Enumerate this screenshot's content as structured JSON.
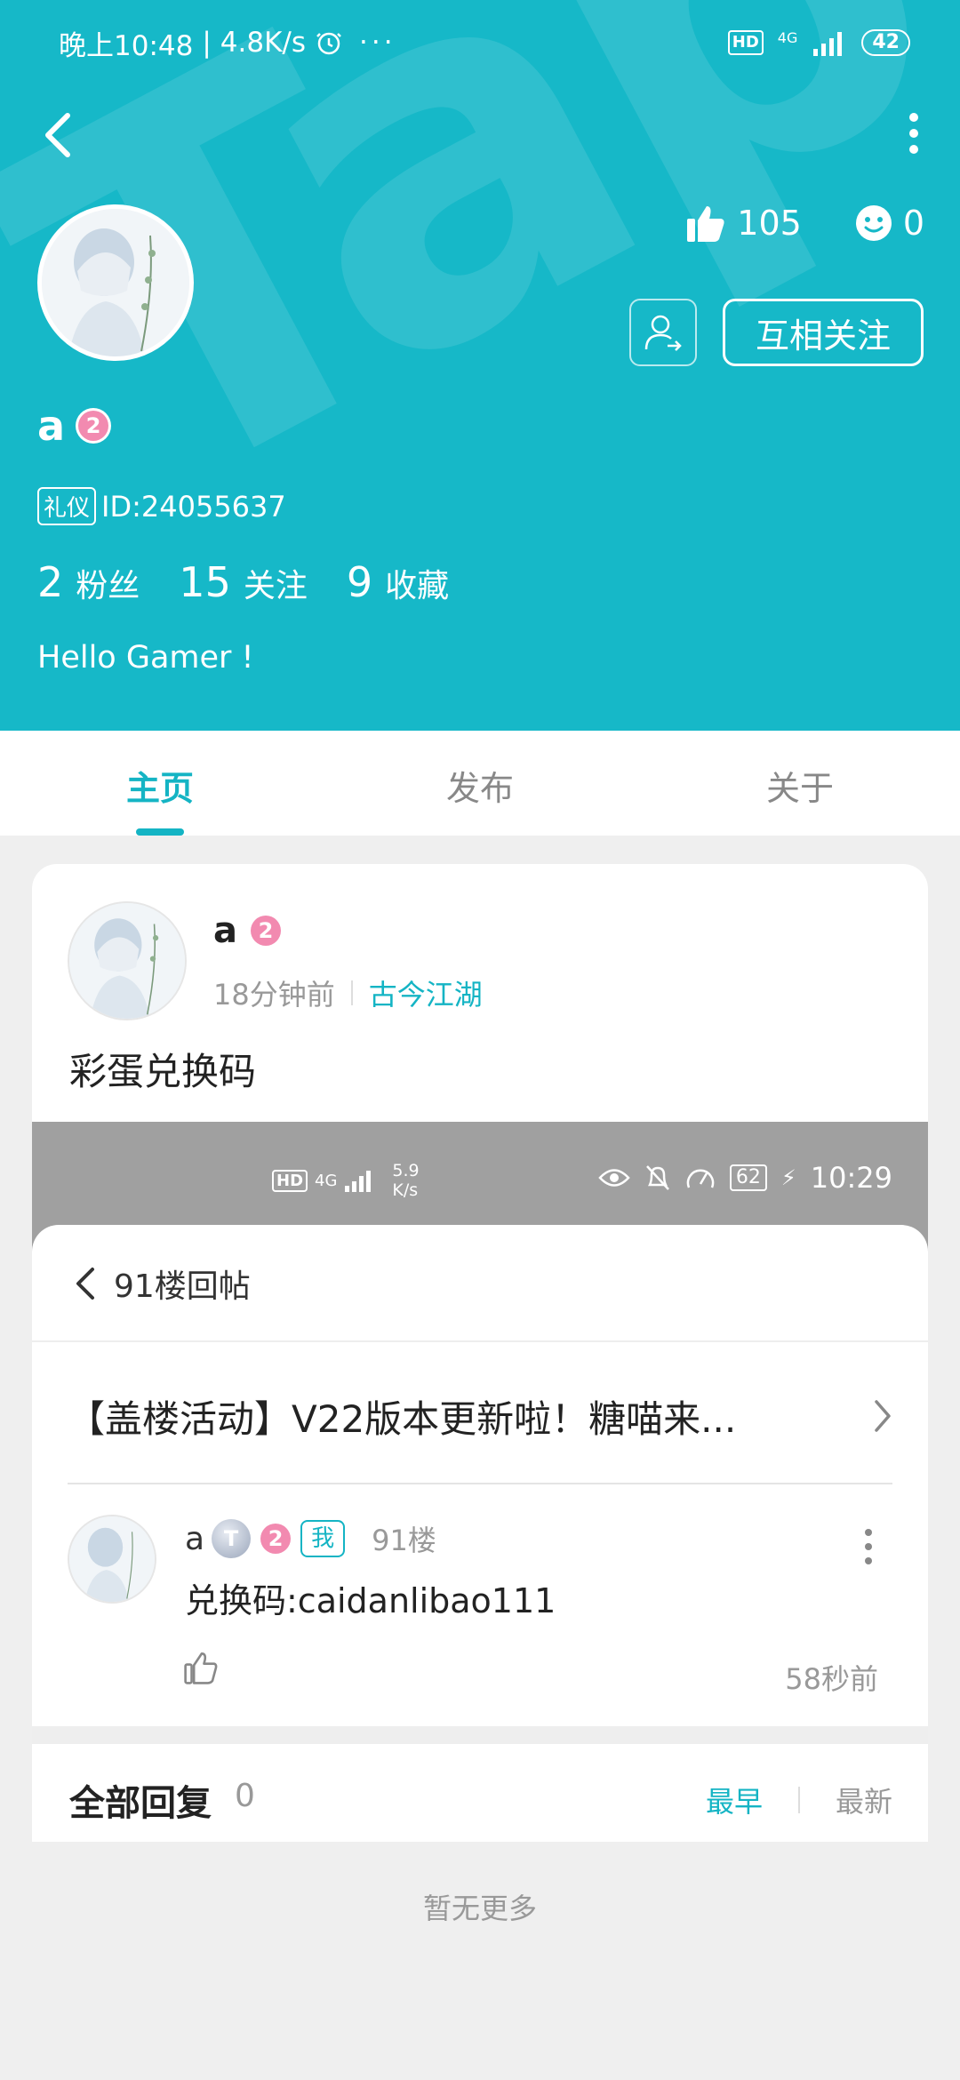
{
  "status_bar": {
    "time": "晚上10:48",
    "speed": "4.8K/s",
    "network": "4G",
    "battery": "42",
    "hd": "HD"
  },
  "profile": {
    "watermark": "TapTap",
    "likes": "105",
    "smiles": "0",
    "mutual_follow_label": "互相关注",
    "username": "a",
    "level": "2",
    "id_tag": "礼仪",
    "id_text": "ID:24055637",
    "stats": [
      {
        "num": "2",
        "label": "粉丝"
      },
      {
        "num": "15",
        "label": "关注"
      },
      {
        "num": "9",
        "label": "收藏"
      }
    ],
    "bio": "Hello Gamer !"
  },
  "tabs": [
    {
      "label": "主页",
      "active": true
    },
    {
      "label": "发布",
      "active": false
    },
    {
      "label": "关于",
      "active": false
    }
  ],
  "post": {
    "author": "a",
    "level": "2",
    "time": "18分钟前",
    "circle": "古今江湖",
    "text": "彩蛋兑换码",
    "embed": {
      "status": {
        "hd": "HD",
        "network": "4G",
        "speed_top": "5.9",
        "speed_bottom": "K/s",
        "battery": "62",
        "time": "10:29"
      },
      "sheet_title": "91楼回帖",
      "thread_title": "【盖楼活动】V22版本更新啦！糖喵来...",
      "reply": {
        "author": "a",
        "medal": "T",
        "level": "2",
        "me_tag": "我",
        "floor": "91楼",
        "text": "兑换码:caidanlibao111",
        "time": "58秒前"
      },
      "all_replies_label": "全部回复",
      "all_replies_count": "0",
      "sort_earliest": "最早",
      "sort_latest": "最新",
      "no_more": "暂无更多"
    }
  },
  "colors": {
    "teal": "#16b8c8",
    "accent": "#14b4c4",
    "level_pink": "#f28ab0"
  }
}
